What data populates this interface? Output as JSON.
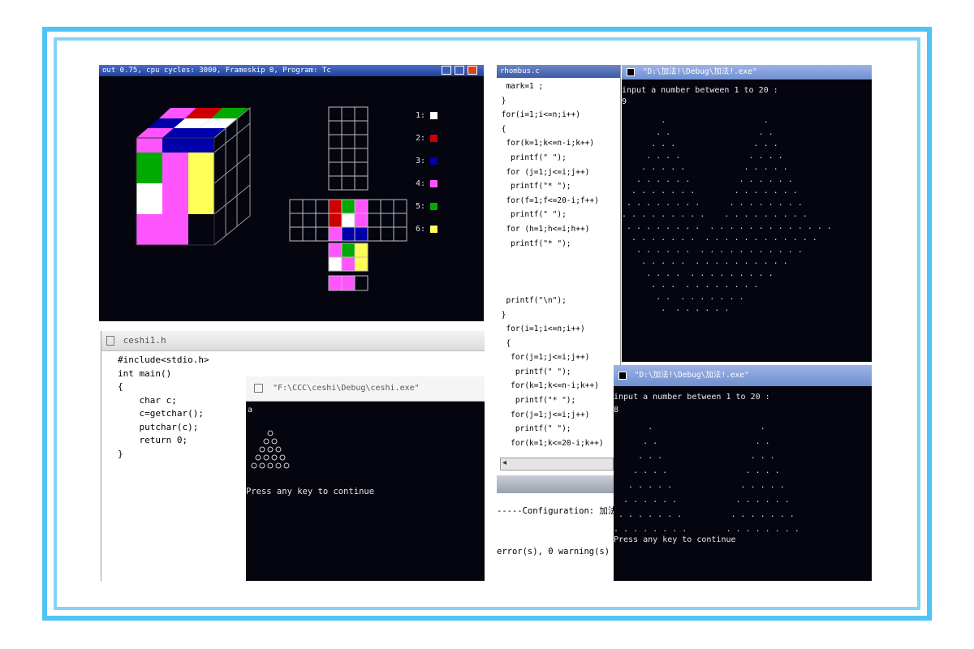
{
  "cube_window": {
    "titlebar": "out 0.75, cpu cycles:      3000, Frameskip  0, Program:        Tc",
    "legend": [
      {
        "label": "1:",
        "color": "#ffffff"
      },
      {
        "label": "2:",
        "color": "#cc0000"
      },
      {
        "label": "3:",
        "color": "#0000aa"
      },
      {
        "label": "4:",
        "color": "#ff55ff"
      },
      {
        "label": "5:",
        "color": "#00aa00"
      },
      {
        "label": "6:",
        "color": "#ffff55"
      }
    ]
  },
  "editor_small": {
    "tab_title": "ceshi1.h",
    "code_lines": [
      "#include<stdio.h>",
      "int main()",
      "{",
      "    char c;",
      "    c=getchar();",
      "    putchar(c);",
      "    return 0;",
      "}"
    ]
  },
  "console_small": {
    "title": "\"F:\\CCC\\ceshi\\Debug\\ceshi.exe\"",
    "first_line": "a",
    "press_key": "Press any key to continue"
  },
  "editor_large": {
    "title": "rhombus.c",
    "code_lines": [
      "  mark=1 ;",
      " }",
      " for(i=1;i<=n;i++)",
      " {",
      "  for(k=1;k<=n-i;k++)",
      "   printf(\" \");",
      "  for (j=1;j<=i;j++)",
      "   printf(\"* \");",
      "  for(f=1;f<=20-i;f++)",
      "   printf(\" \");",
      "  for (h=1;h<=i;h++)",
      "   printf(\"* \");",
      "",
      "",
      "",
      "  printf(\"\\n\");",
      " }",
      "  for(i=1;i<=n;i++)",
      "  {",
      "   for(j=1;j<=i;j++)",
      "    printf(\" \");",
      "   for(k=1;k<=n-i;k++)",
      "    printf(\"* \");",
      "   for(j=1;j<=i;j++)",
      "    printf(\" \");",
      "   for(k=1;k<=20-i;k++)"
    ],
    "build_config": "-----Configuration: 加法",
    "build_result": "error(s), 0 warning(s)"
  },
  "console_top": {
    "title": "\"D:\\加法!\\Debug\\加法!.exe\"",
    "prompt": "input a number between 1 to 20 :",
    "input": "9"
  },
  "console_bottom": {
    "title": "\"D:\\加法!\\Debug\\加法!.exe\"",
    "prompt": "input a number between 1 to 20 :",
    "input": "8",
    "press_key": "Press any key to continue"
  }
}
